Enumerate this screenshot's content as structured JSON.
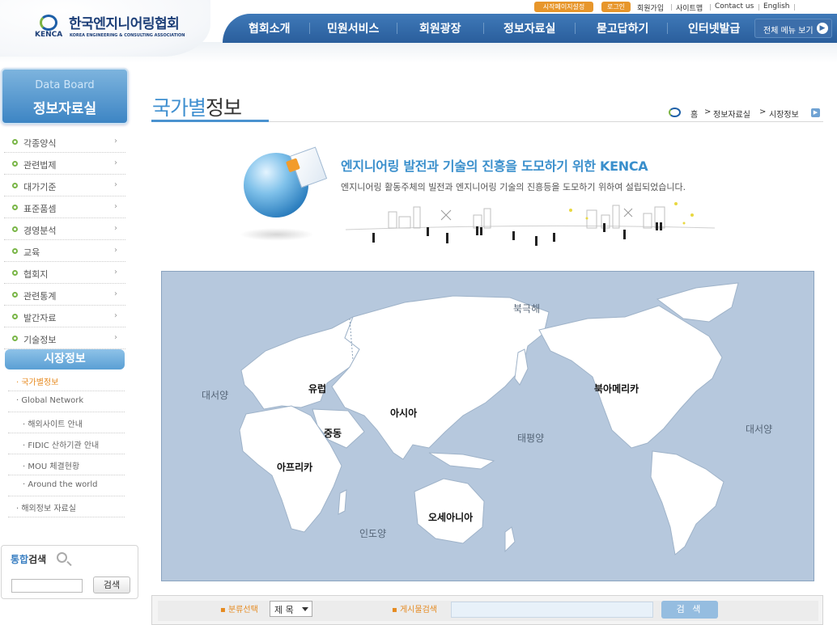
{
  "header": {
    "logo_kor": "한국엔지니어링협회",
    "logo_kenca": "KENCA",
    "logo_eng": "KOREA ENGINEERING & CONSULTING ASSOCIATION",
    "util": {
      "start_page": "시작페이지설정",
      "login": "로그인",
      "join": "회원가입",
      "sitemap": "사이트맵",
      "contact": "Contact us",
      "english": "English"
    },
    "nav": [
      "협회소개",
      "민원서비스",
      "회원광장",
      "정보자료실",
      "묻고답하기",
      "인터넷발급"
    ],
    "all_menu": "전체 메뉴 보기",
    "all_menu_icon": "arrow-right-icon"
  },
  "sidebar": {
    "sub_title": "Data Board",
    "title": "정보자료실",
    "items": [
      "각종양식",
      "관련법제",
      "대가기준",
      "표준품셈",
      "경영분석",
      "교육",
      "협회지",
      "관련통계",
      "발간자료",
      "기술정보"
    ],
    "active": "시장정보",
    "sub_items": [
      {
        "label": "· 국가별정보",
        "selected": true,
        "deep": false
      },
      {
        "label": "· Global Network",
        "selected": false,
        "deep": false
      },
      {
        "label": "· 해외사이트 안내",
        "selected": false,
        "deep": true
      },
      {
        "label": "· FIDIC 산하기관 안내",
        "selected": false,
        "deep": true
      },
      {
        "label": "· MOU 체결현황",
        "selected": false,
        "deep": true
      },
      {
        "label": "· Around the world",
        "selected": false,
        "deep": true
      },
      {
        "label": "· 해외정보 자료실",
        "selected": false,
        "deep": false
      }
    ],
    "search": {
      "title_blue": "통합",
      "title_dark": "검색",
      "button": "검색"
    }
  },
  "main": {
    "title_highlight": "국가별",
    "title_rest": "정보",
    "breadcrumb": {
      "home": "홈",
      "sep": ">",
      "section": "정보자료실",
      "current": "시장정보"
    },
    "banner": {
      "title": "엔지니어링 발전과 기술의 진흥을 도모하기 위한 KENCA",
      "desc": "엔지니어링 활동주체의 빌전과 엔지니어링 기술의 진흥등을 도모하기 위하여 설립되었습니다."
    },
    "map": {
      "oceans": {
        "arctic": "북극해",
        "atlantic_left": "대서양",
        "pacific": "태평양",
        "atlantic_right": "대서양",
        "indian": "인도양"
      },
      "continents": {
        "europe": "유럽",
        "asia": "아시아",
        "middle_east": "중동",
        "africa": "아프리카",
        "north_america": "북아메리카",
        "oceania": "오세아니아"
      }
    },
    "bottom_search": {
      "category_label": "분류선택",
      "category_value": "제 목",
      "board_label": "게시물검색",
      "button": "검 색"
    }
  },
  "colors": {
    "nav": "#2f66a6",
    "accent_blue": "#3f8fd0",
    "accent_orange": "#e78a1f",
    "map_sea": "#b6c8dd",
    "map_land": "#ffffff"
  }
}
